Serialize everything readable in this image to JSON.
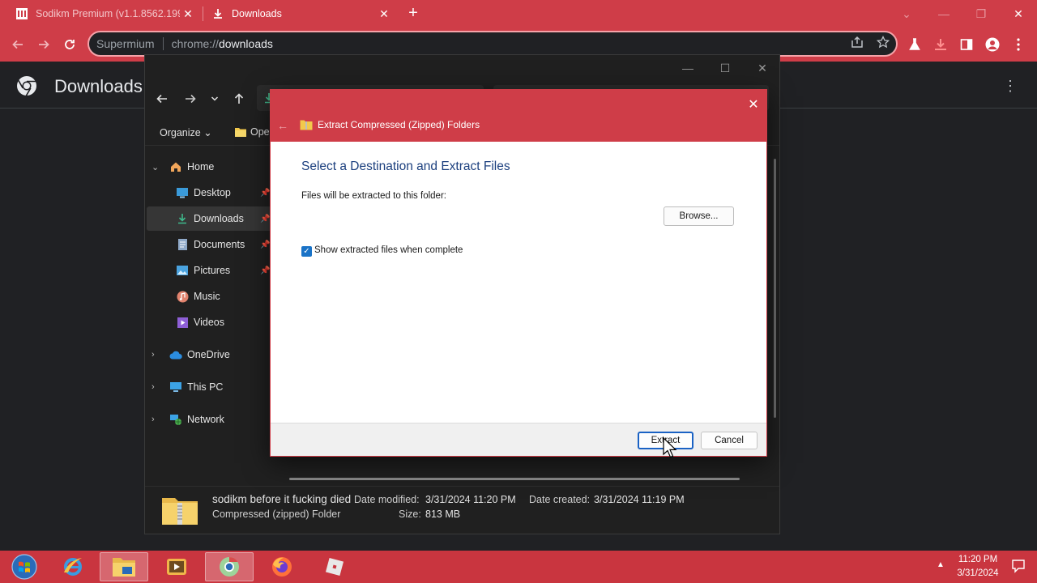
{
  "browser": {
    "tabs": [
      {
        "title": "Sodikm Premium (v1.1.8562.199",
        "active": false
      },
      {
        "title": "Downloads",
        "active": true
      }
    ],
    "omnibox": {
      "site": "Supermium",
      "scheme": "chrome://",
      "host": "downloads"
    }
  },
  "downloads_page": {
    "title": "Downloads"
  },
  "explorer": {
    "command_bar": {
      "organize": "Organize",
      "open": "Open"
    },
    "nav": [
      {
        "label": "Home"
      },
      {
        "label": "Desktop"
      },
      {
        "label": "Downloads"
      },
      {
        "label": "Documents"
      },
      {
        "label": "Pictures"
      },
      {
        "label": "Music"
      },
      {
        "label": "Videos"
      },
      {
        "label": "OneDrive"
      },
      {
        "label": "This PC"
      },
      {
        "label": "Network"
      }
    ],
    "details": {
      "name": "sodikm before it fucking died",
      "type": "Compressed (zipped) Folder",
      "date_modified_label": "Date modified:",
      "date_modified": "3/31/2024 11:20 PM",
      "date_created_label": "Date created:",
      "date_created": "3/31/2024 11:19 PM",
      "size_label": "Size:",
      "size": "813 MB"
    }
  },
  "dialog": {
    "title": "Extract Compressed (Zipped) Folders",
    "heading": "Select a Destination and Extract Files",
    "dest_label": "Files will be extracted to this folder:",
    "browse": "Browse...",
    "show_files_label": "Show extracted files when complete",
    "show_files_checked": true,
    "extract": "Extract",
    "cancel": "Cancel"
  },
  "taskbar": {
    "time": "11:20 PM",
    "date": "3/31/2024"
  },
  "colors": {
    "accent": "#cf3d48",
    "heading": "#1b3f7e",
    "checkbox": "#1a73c7"
  }
}
